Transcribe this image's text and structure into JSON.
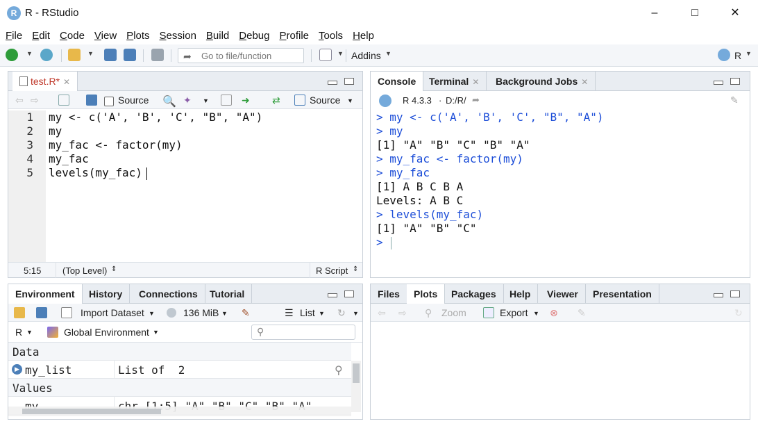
{
  "window": {
    "title": "R - RStudio",
    "app_icon": "R"
  },
  "menu": [
    "File",
    "Edit",
    "Code",
    "View",
    "Plots",
    "Session",
    "Build",
    "Debug",
    "Profile",
    "Tools",
    "Help"
  ],
  "toolbar": {
    "goto_placeholder": "Go to file/function",
    "addins": "Addins",
    "project": "R"
  },
  "editor": {
    "tab": "test.R*",
    "source_on_save": "Source",
    "source_button": "Source",
    "line_numbers": [
      "1",
      "2",
      "3",
      "4",
      "5"
    ],
    "lines": [
      "my <- c('A', 'B', 'C', \"B\", \"A\")",
      "my",
      "my_fac <- factor(my)",
      "my_fac",
      "levels(my_fac)"
    ],
    "status_pos": "5:15",
    "status_scope": "(Top Level)",
    "status_type": "R Script"
  },
  "console_pane": {
    "tabs": [
      "Console",
      "Terminal",
      "Background Jobs"
    ],
    "version": "R 4.3.3",
    "dot": "·",
    "path": "D:/R/",
    "lines": [
      {
        "kind": "cmd",
        "text": "> my <- c('A', 'B', 'C', \"B\", \"A\")"
      },
      {
        "kind": "cmd",
        "text": "> my"
      },
      {
        "kind": "out",
        "text": "[1] \"A\" \"B\" \"C\" \"B\" \"A\""
      },
      {
        "kind": "cmd",
        "text": "> my_fac <- factor(my)"
      },
      {
        "kind": "cmd",
        "text": "> my_fac"
      },
      {
        "kind": "out",
        "text": "[1] A B C B A"
      },
      {
        "kind": "out",
        "text": "Levels: A B C"
      },
      {
        "kind": "cmd",
        "text": "> levels(my_fac)"
      },
      {
        "kind": "out",
        "text": "[1] \"A\" \"B\" \"C\""
      },
      {
        "kind": "cmd",
        "text": "> "
      }
    ]
  },
  "env_pane": {
    "tabs": [
      "Environment",
      "History",
      "Connections",
      "Tutorial"
    ],
    "import_dataset": "Import Dataset",
    "memory": "136 MiB",
    "view_mode": "List",
    "language": "R",
    "scope": "Global Environment",
    "section_data": "Data",
    "section_values": "Values",
    "rows": [
      {
        "name": "my_list",
        "value": "List of  2"
      },
      {
        "name": "my",
        "value": "chr [1:5] \"A\" \"B\" \"C\" \"B\" \"A\""
      }
    ]
  },
  "files_pane": {
    "tabs": [
      "Files",
      "Plots",
      "Packages",
      "Help",
      "Viewer",
      "Presentation"
    ],
    "zoom": "Zoom",
    "export": "Export"
  },
  "colors": {
    "accent": "#75aadb",
    "toolbar_bg": "#f4f6f9",
    "tab_bg": "#e9edf2",
    "command": "#1d4ed8",
    "string": "#036a07"
  }
}
